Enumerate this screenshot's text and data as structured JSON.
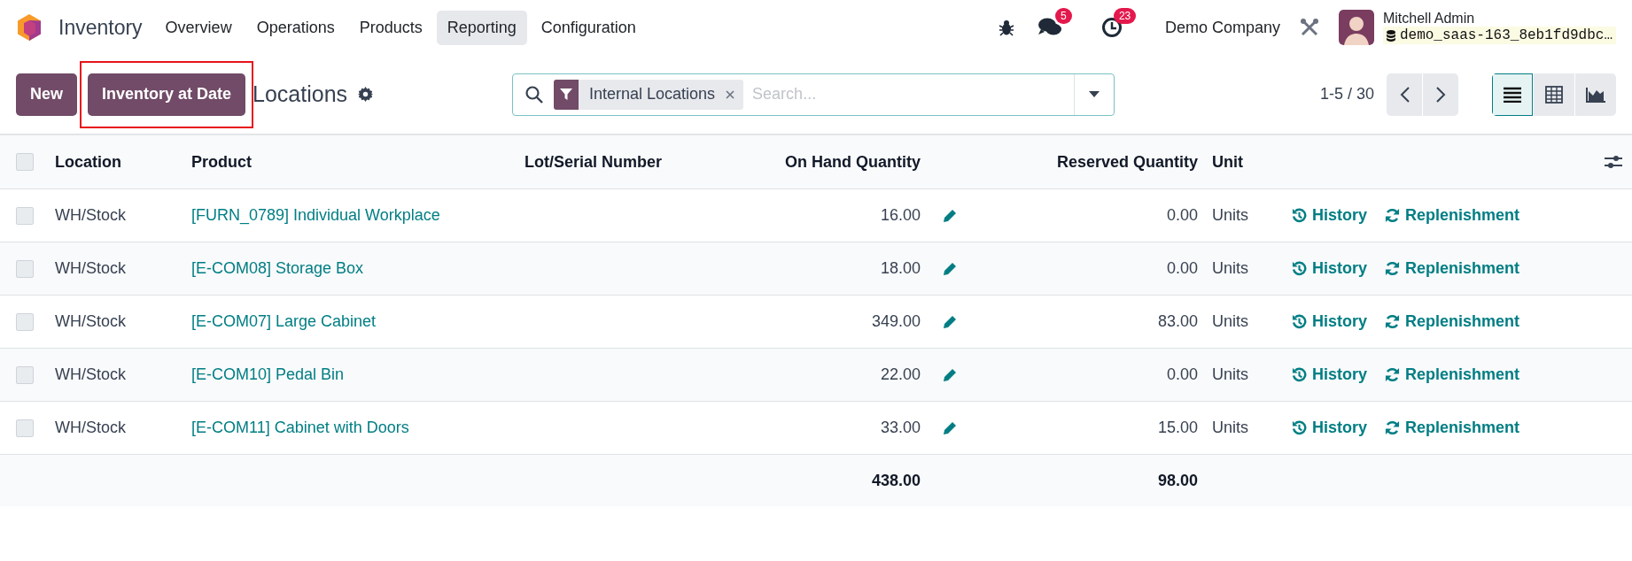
{
  "navbar": {
    "app_name": "Inventory",
    "menu": [
      {
        "label": "Overview",
        "selected": false
      },
      {
        "label": "Operations",
        "selected": false
      },
      {
        "label": "Products",
        "selected": false
      },
      {
        "label": "Reporting",
        "selected": true
      },
      {
        "label": "Configuration",
        "selected": false
      }
    ],
    "messages_count": "5",
    "activities_count": "23",
    "company": "Demo Company",
    "user": {
      "name": "Mitchell Admin",
      "database": "demo_saas-163_8eb1fd9dbc…"
    }
  },
  "control_panel": {
    "buttons": [
      {
        "label": "New",
        "highlighted": false
      },
      {
        "label": "Inventory at Date",
        "highlighted": true
      }
    ],
    "title": "Locations",
    "search": {
      "facets": [
        {
          "label": "Internal Locations"
        }
      ],
      "placeholder": "Search..."
    },
    "pager": "1-5 / 30",
    "views": [
      {
        "kind": "list",
        "selected": true
      },
      {
        "kind": "pivot",
        "selected": false
      },
      {
        "kind": "graph",
        "selected": false
      }
    ]
  },
  "table": {
    "all_selected": false,
    "columns": [
      {
        "label": "Location"
      },
      {
        "label": "Product"
      },
      {
        "label": "Lot/Serial Number"
      },
      {
        "label": "On Hand Quantity"
      },
      {
        "label": "Reserved Quantity"
      },
      {
        "label": "Unit"
      }
    ],
    "rows": [
      {
        "selected": false,
        "location": "WH/Stock",
        "product": "[FURN_0789] Individual Workplace",
        "on_hand": "16.00",
        "reserved": "0.00",
        "unit": "Units",
        "history": "History",
        "replenishment": "Replenishment"
      },
      {
        "selected": false,
        "location": "WH/Stock",
        "product": "[E-COM08] Storage Box",
        "on_hand": "18.00",
        "reserved": "0.00",
        "unit": "Units",
        "history": "History",
        "replenishment": "Replenishment"
      },
      {
        "selected": false,
        "location": "WH/Stock",
        "product": "[E-COM07] Large Cabinet",
        "on_hand": "349.00",
        "reserved": "83.00",
        "unit": "Units",
        "history": "History",
        "replenishment": "Replenishment"
      },
      {
        "selected": false,
        "location": "WH/Stock",
        "product": "[E-COM10] Pedal Bin",
        "on_hand": "22.00",
        "reserved": "0.00",
        "unit": "Units",
        "history": "History",
        "replenishment": "Replenishment"
      },
      {
        "selected": false,
        "location": "WH/Stock",
        "product": "[E-COM11] Cabinet with Doors",
        "on_hand": "33.00",
        "reserved": "15.00",
        "unit": "Units",
        "history": "History",
        "replenishment": "Replenishment"
      }
    ],
    "totals": {
      "on_hand": "438.00",
      "reserved": "98.00"
    }
  }
}
